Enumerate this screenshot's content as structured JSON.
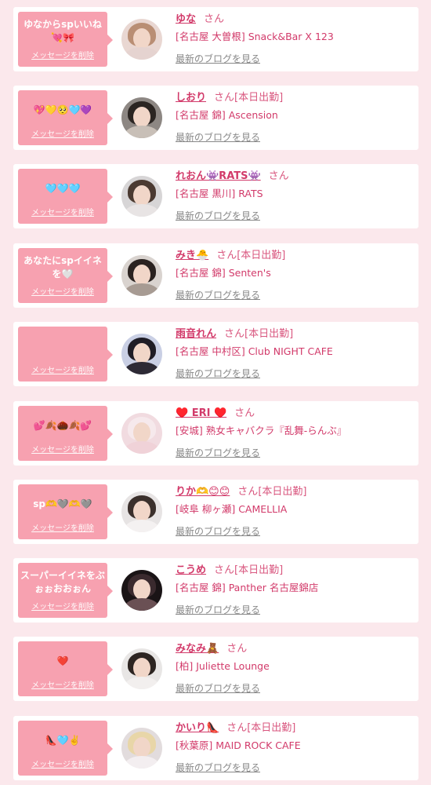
{
  "delete_label": "メッセージを削除",
  "blog_label": "最新のブログを見る",
  "san_label": "さん",
  "shift_label": "[本日出勤]",
  "colors": {
    "background": "#fbe8ec",
    "bubble": "#f7a1b0",
    "name": "#d23a6a",
    "link_gray": "#888888"
  },
  "messages": [
    {
      "message": "ゆなからspいいね💘🎀",
      "name": "ゆな",
      "on_shift": false,
      "shop": "[名古屋 大曽根] Snack&Bar X 123",
      "avatar": {
        "bg": "#e9d7d2",
        "hair": "#b98e74",
        "shoulders": "#e5d3d0"
      }
    },
    {
      "message": "💖💛🥺🩵💜",
      "name": "しおり",
      "on_shift": true,
      "shop": "[名古屋 錦] Ascension",
      "avatar": {
        "bg": "#8d8783",
        "hair": "#2b2522",
        "shoulders": "#c8bfb7"
      }
    },
    {
      "message": "🩵🩵🩵",
      "name": "れおん👾RATS👾",
      "on_shift": false,
      "shop": "[名古屋 黒川] RATS",
      "avatar": {
        "bg": "#d7d5d6",
        "hair": "#4b3a31",
        "shoulders": "#e8e4e4"
      }
    },
    {
      "message": "あなたにspイイネを🤍",
      "name": "みき🐣",
      "on_shift": true,
      "shop": "[名古屋 錦] Senten's",
      "avatar": {
        "bg": "#d9d3cf",
        "hair": "#2a2220",
        "shoulders": "#a79b93"
      }
    },
    {
      "message": "",
      "name": "雨音れん",
      "on_shift": true,
      "shop": "[名古屋 中村区] Club NIGHT CAFE",
      "avatar": {
        "bg": "#c9cfe4",
        "hair": "#1f1d26",
        "shoulders": "#2d2a35"
      }
    },
    {
      "message": "💕🍂🌰🍂💕",
      "name": "♥️ ERI ♥️",
      "on_shift": false,
      "shop": "[安城] 熟女キャバクラ『乱舞-らんぶ』",
      "avatar": {
        "bg": "#f1dbe0",
        "hair": "#f6e9ec",
        "shoulders": "#f0d2d8"
      }
    },
    {
      "message": "sp🫶🩶🫶🩶",
      "name": "りか🫶😊😊",
      "on_shift": true,
      "shop": "[岐阜 柳ヶ瀬] CAMELLIA",
      "avatar": {
        "bg": "#e7e4e4",
        "hair": "#3b302c",
        "shoulders": "#f4f1f1"
      }
    },
    {
      "message": "スーパーイイネをぶぉぉおおぉん",
      "name": "こうめ",
      "on_shift": true,
      "shop": "[名古屋 錦] Panther 名古屋錦店",
      "avatar": {
        "bg": "#1a1416",
        "hair": "#3a2a2e",
        "shoulders": "#6a5054"
      }
    },
    {
      "message": "❤️",
      "name": "みなみ🧸",
      "on_shift": false,
      "shop": "[柏] Juliette Lounge",
      "avatar": {
        "bg": "#e8e6e5",
        "hair": "#2d2522",
        "shoulders": "#f2efee"
      }
    },
    {
      "message": "👠🩵✌️",
      "name": "かいり👠",
      "on_shift": true,
      "shop": "[秋葉原] MAID ROCK CAFE",
      "avatar": {
        "bg": "#e2dcdd",
        "hair": "#e8d6a8",
        "shoulders": "#f3eef0"
      }
    }
  ]
}
